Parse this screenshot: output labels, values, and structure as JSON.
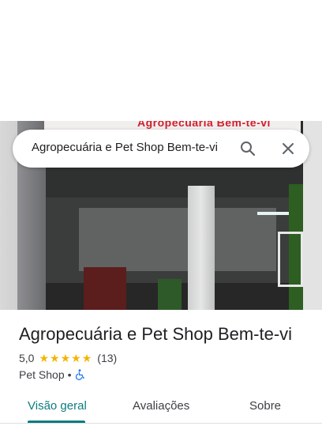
{
  "search": {
    "query": "Agropecuária e Pet Shop Bem-te-vi"
  },
  "photo": {
    "sign_text": "Agropecuária Bem-te-vi"
  },
  "place": {
    "name": "Agropecuária e Pet Shop Bem-te-vi",
    "rating": "5,0",
    "stars": 5,
    "review_count": "(13)",
    "category": "Pet Shop",
    "separator": "•",
    "accessibility_icon": "wheelchair-icon"
  },
  "tabs": [
    {
      "label": "Visão geral",
      "active": true
    },
    {
      "label": "Avaliações",
      "active": false
    },
    {
      "label": "Sobre",
      "active": false
    }
  ],
  "colors": {
    "accent": "#0b7c80",
    "star": "#f4b400",
    "sign_red": "#d21e2b",
    "accessibility_blue": "#1a73e8"
  }
}
